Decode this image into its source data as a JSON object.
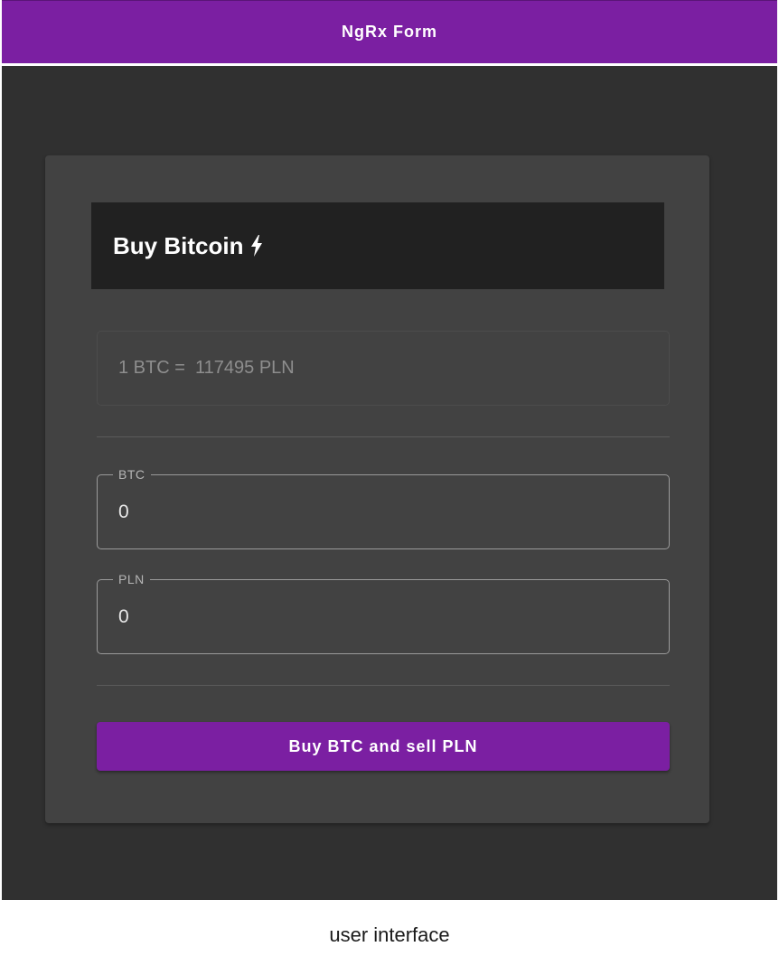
{
  "toolbar": {
    "title": "NgRx Form"
  },
  "card": {
    "title": "Buy Bitcoin",
    "header_icon": "bolt-icon",
    "rate": "1 BTC =  117495 PLN",
    "fields": [
      {
        "label": "BTC",
        "value": "0"
      },
      {
        "label": "PLN",
        "value": "0"
      }
    ],
    "buy_button": "Buy BTC and sell PLN"
  },
  "caption": "user interface",
  "colors": {
    "primary": "#7b1fa2",
    "background": "#303030",
    "card": "#424242",
    "card_header": "#212121"
  }
}
